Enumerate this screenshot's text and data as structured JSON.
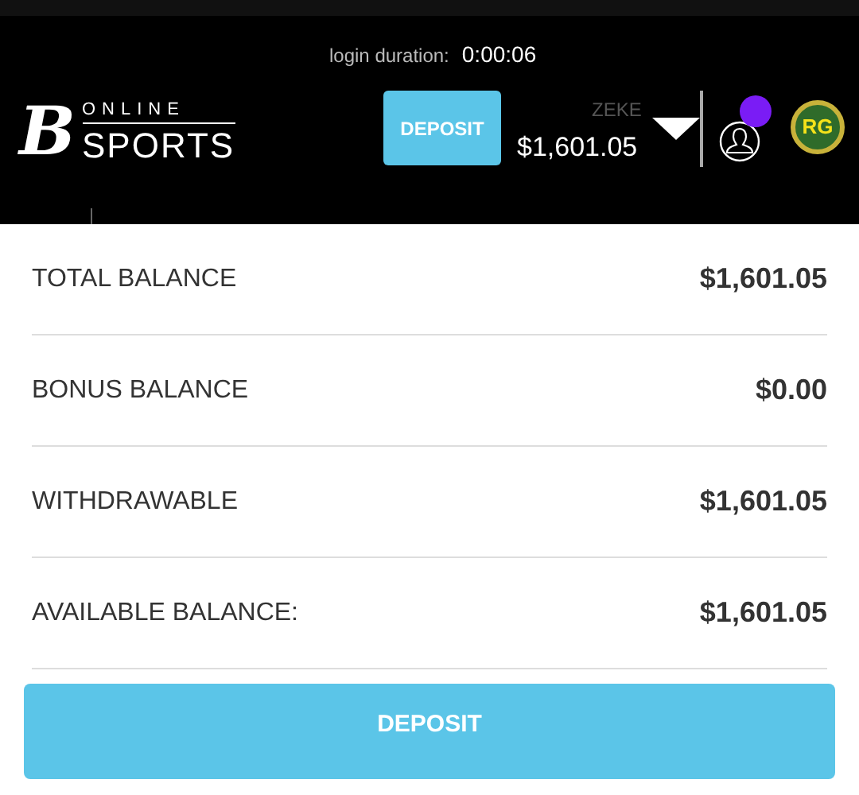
{
  "header": {
    "login_duration_label": "login duration:",
    "login_duration": "0:00:06",
    "logo": {
      "mark": "B",
      "line_1": "ONLINE",
      "line_2": "SPORTS"
    },
    "deposit_button": "DEPOSIT",
    "username": "ZEKE",
    "balance": "$1,601.05",
    "notification": true,
    "badge": "RG"
  },
  "balances": [
    {
      "label": "TOTAL BALANCE",
      "value": "$1,601.05"
    },
    {
      "label": "BONUS BALANCE",
      "value": "$0.00"
    },
    {
      "label": "WITHDRAWABLE",
      "value": "$1,601.05"
    },
    {
      "label": "AVAILABLE BALANCE:",
      "value": "$1,601.05"
    }
  ],
  "deposit_button": "DEPOSIT"
}
